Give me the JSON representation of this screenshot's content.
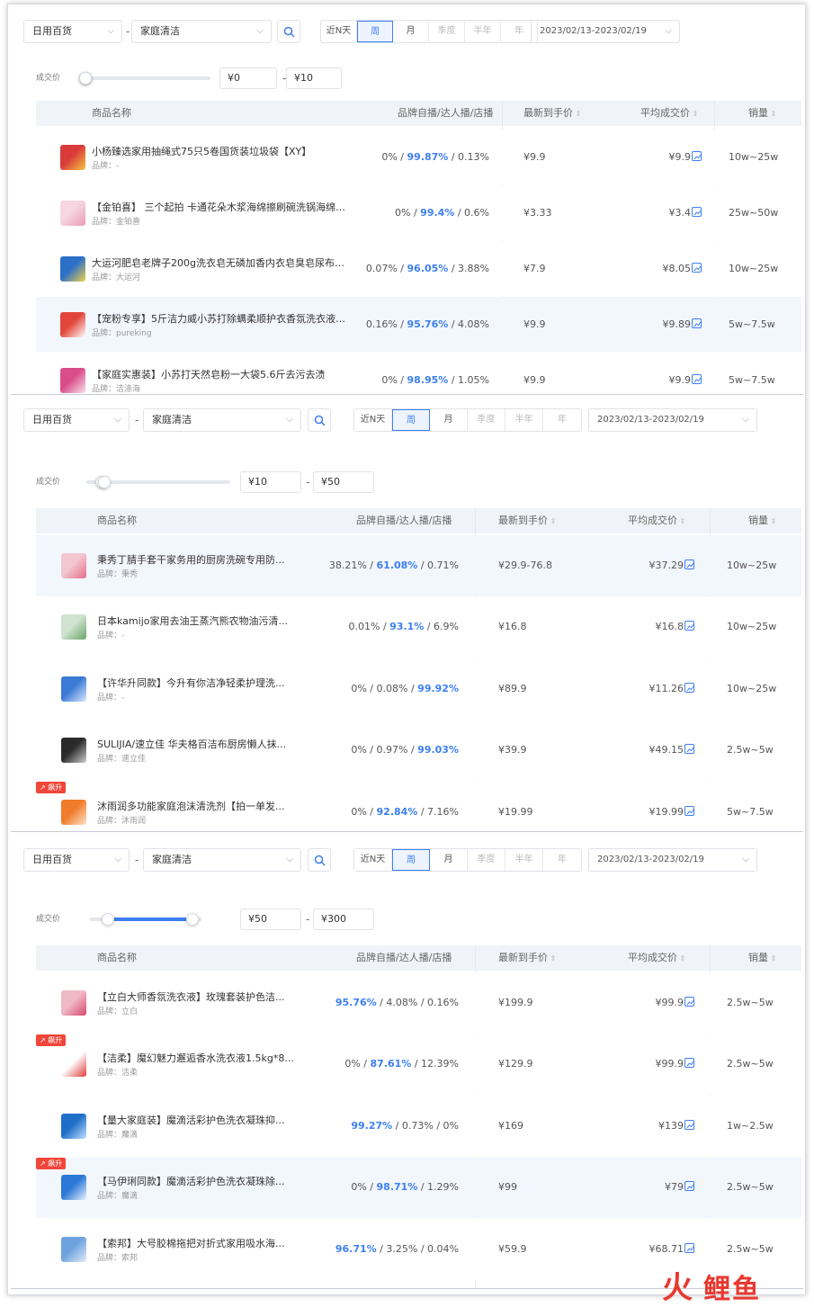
{
  "panels": [
    {
      "category": "日用百货",
      "subcategory": "家庭清洁",
      "periods": [
        "近N天",
        "周",
        "月",
        "季度",
        "半年",
        "年"
      ],
      "active_period": 1,
      "date_range": "2023/02/13-2023/02/19",
      "price_label": "成交价",
      "price_min": "¥0",
      "price_max": "¥10",
      "slider": {
        "low": 0,
        "high": 0
      },
      "headers": {
        "name": "商品名称",
        "ratio": "品牌自播/达人播/店播",
        "latest": "最新到手价",
        "avg": "平均成交价",
        "sales": "销量"
      },
      "rows": [
        {
          "name": "小杨臻选家用抽绳式75只5卷国货装垃圾袋【XY】",
          "brand": "品牌：-",
          "a": "0%",
          "b": "99.87%",
          "c": "0.13%",
          "bold": 1,
          "latest": "¥9.9",
          "avg": "¥9.9",
          "sales": "10w~25w",
          "highlight": false,
          "badge": ""
        },
        {
          "name": "【金铂喜】 三个起拍 卡通花朵木浆海绵擦刷碗洗锅海绵擦...",
          "brand": "品牌：金铂喜",
          "a": "0%",
          "b": "99.4%",
          "c": "0.6%",
          "bold": 1,
          "latest": "¥3.33",
          "avg": "¥3.4",
          "sales": "25w~50w",
          "highlight": false,
          "badge": ""
        },
        {
          "name": "大运河肥皂老牌子200g洗衣皂无磷加香内衣皂臭皂尿布皂...",
          "brand": "品牌：大运河",
          "a": "0.07%",
          "b": "96.05%",
          "c": "3.88%",
          "bold": 1,
          "latest": "¥7.9",
          "avg": "¥8.05",
          "sales": "10w~25w",
          "highlight": false,
          "badge": ""
        },
        {
          "name": "【宠粉专享】5斤洁力威小苏打除螨柔顺护衣香氛洗衣液去...",
          "brand": "品牌：pureking",
          "a": "0.16%",
          "b": "95.76%",
          "c": "4.08%",
          "bold": 1,
          "latest": "¥9.9",
          "avg": "¥9.89",
          "sales": "5w~7.5w",
          "highlight": true,
          "badge": ""
        },
        {
          "name": "【家庭实惠装】小苏打天然皂粉一大袋5.6斤去污去渍",
          "brand": "品牌：洁涤海",
          "a": "0%",
          "b": "98.95%",
          "c": "1.05%",
          "bold": 1,
          "latest": "¥9.9",
          "avg": "¥9.9",
          "sales": "5w~7.5w",
          "highlight": false,
          "badge": ""
        }
      ]
    },
    {
      "category": "日用百货",
      "subcategory": "家庭清洁",
      "periods": [
        "近N天",
        "周",
        "月",
        "季度",
        "半年",
        "年"
      ],
      "active_period": 1,
      "date_range": "2023/02/13-2023/02/19",
      "price_label": "成交价",
      "price_min": "¥10",
      "price_max": "¥50",
      "slider": {
        "low": 0.1,
        "high": 0.12
      },
      "headers": {
        "name": "商品名称",
        "ratio": "品牌自播/达人播/店播",
        "latest": "最新到手价",
        "avg": "平均成交价",
        "sales": "销量"
      },
      "rows": [
        {
          "name": "秉秀丁腈手套干家务用的厨房洗碗专用防...",
          "brand": "品牌：秉秀",
          "a": "38.21%",
          "b": "61.08%",
          "c": "0.71%",
          "bold": 1,
          "latest": "¥29.9-76.8",
          "avg": "¥37.29",
          "sales": "10w~25w",
          "highlight": true,
          "badge": ""
        },
        {
          "name": "日本kamijo家用去油王蒸汽熊农物油污清...",
          "brand": "品牌：-",
          "a": "0.01%",
          "b": "93.1%",
          "c": "6.9%",
          "bold": 1,
          "latest": "¥16.8",
          "avg": "¥16.8",
          "sales": "10w~25w",
          "highlight": false,
          "badge": ""
        },
        {
          "name": "【许华升同款】今升有你洁净轻柔护理洗...",
          "brand": "品牌：-",
          "a": "0%",
          "b": "0.08%",
          "c": "99.92%",
          "bold": 2,
          "latest": "¥89.9",
          "avg": "¥11.26",
          "sales": "10w~25w",
          "highlight": false,
          "badge": ""
        },
        {
          "name": "SULIJIA/速立佳 华夫格百洁布厨房懒人抹...",
          "brand": "品牌：速立佳",
          "a": "0%",
          "b": "0.97%",
          "c": "99.03%",
          "bold": 2,
          "latest": "¥39.9",
          "avg": "¥49.15",
          "sales": "2.5w~5w",
          "highlight": false,
          "badge": ""
        },
        {
          "name": "沐雨润多功能家庭泡沫清洗剂【拍一单发...",
          "brand": "品牌：沐雨润",
          "a": "0%",
          "b": "92.84%",
          "c": "7.16%",
          "bold": 1,
          "latest": "¥19.99",
          "avg": "¥19.99",
          "sales": "5w~7.5w",
          "highlight": false,
          "badge": "飙升"
        }
      ]
    },
    {
      "category": "日用百货",
      "subcategory": "家庭清洁",
      "periods": [
        "近N天",
        "周",
        "月",
        "季度",
        "半年",
        "年"
      ],
      "active_period": 1,
      "date_range": "2023/02/13-2023/02/19",
      "price_label": "成交价",
      "price_min": "¥50",
      "price_max": "¥300",
      "slider": {
        "low": 0.15,
        "high": 0.91
      },
      "headers": {
        "name": "商品名称",
        "ratio": "品牌自播/达人播/店播",
        "latest": "最新到手价",
        "avg": "平均成交价",
        "sales": "销量"
      },
      "rows": [
        {
          "name": "【立白大师香氛洗衣液】玫瑰套装护色洁...",
          "brand": "品牌：立白",
          "a": "95.76%",
          "b": "4.08%",
          "c": "0.16%",
          "bold": 0,
          "latest": "¥199.9",
          "avg": "¥99.9",
          "sales": "2.5w~5w",
          "highlight": false,
          "badge": ""
        },
        {
          "name": "【洁柔】魔幻魅力邂逅香水洗衣液1.5kg*8...",
          "brand": "品牌：洁柔",
          "a": "0%",
          "b": "87.61%",
          "c": "12.39%",
          "bold": 1,
          "latest": "¥129.9",
          "avg": "¥99.9",
          "sales": "2.5w~5w",
          "highlight": false,
          "badge": "飙升"
        },
        {
          "name": "【量大家庭装】魔滴活彩护色洗衣凝珠抑...",
          "brand": "品牌：魔滴",
          "a": "99.27%",
          "b": "0.73%",
          "c": "0%",
          "bold": 0,
          "latest": "¥169",
          "avg": "¥139",
          "sales": "1w~2.5w",
          "highlight": false,
          "badge": ""
        },
        {
          "name": "【马伊琍同款】魔滴活彩护色洗衣凝珠除...",
          "brand": "品牌：魔滴",
          "a": "0%",
          "b": "98.71%",
          "c": "1.29%",
          "bold": 1,
          "latest": "¥99",
          "avg": "¥79",
          "sales": "2.5w~5w",
          "highlight": true,
          "badge": "飙升"
        },
        {
          "name": "【索邦】大号胶棉拖把对折式家用吸水海...",
          "brand": "品牌：索邦",
          "a": "96.71%",
          "b": "3.25%",
          "c": "0.04%",
          "bold": 0,
          "latest": "¥59.9",
          "avg": "¥68.71",
          "sales": "2.5w~5w",
          "highlight": false,
          "badge": ""
        }
      ]
    }
  ],
  "watermark_logo": {
    "char1": "火",
    "chars": "鲤鱼"
  },
  "colors": {
    "accent": "#3d7ff2",
    "badge": "#f1463a",
    "header_bg": "#f0f3f8",
    "highlight_row": "#f2f6fd"
  },
  "thumbnail_colors": [
    [
      "#d93a3a",
      "#f5c542"
    ],
    [
      "#f6d6e0",
      "#e99ab4"
    ],
    [
      "#2b6fc9",
      "#f2d24a"
    ],
    [
      "#e2463b",
      "#ffffff"
    ],
    [
      "#d94d8a",
      "#f7e1ec"
    ],
    [
      "#f3c7cf",
      "#e36f8a"
    ],
    [
      "#cfe3cf",
      "#6aa56a"
    ],
    [
      "#3b7bd6",
      "#dbe9fb"
    ],
    [
      "#2a2a2a",
      "#cfcfcf"
    ],
    [
      "#f07b2a",
      "#ffe4c9"
    ],
    [
      "#f0b9c6",
      "#d8486e"
    ],
    [
      "#ffffff",
      "#e03b3b"
    ],
    [
      "#1f6fc9",
      "#bfe0ff"
    ],
    [
      "#2b78d6",
      "#e8f2ff"
    ],
    [
      "#6fa3df",
      "#e3ecf7"
    ]
  ]
}
